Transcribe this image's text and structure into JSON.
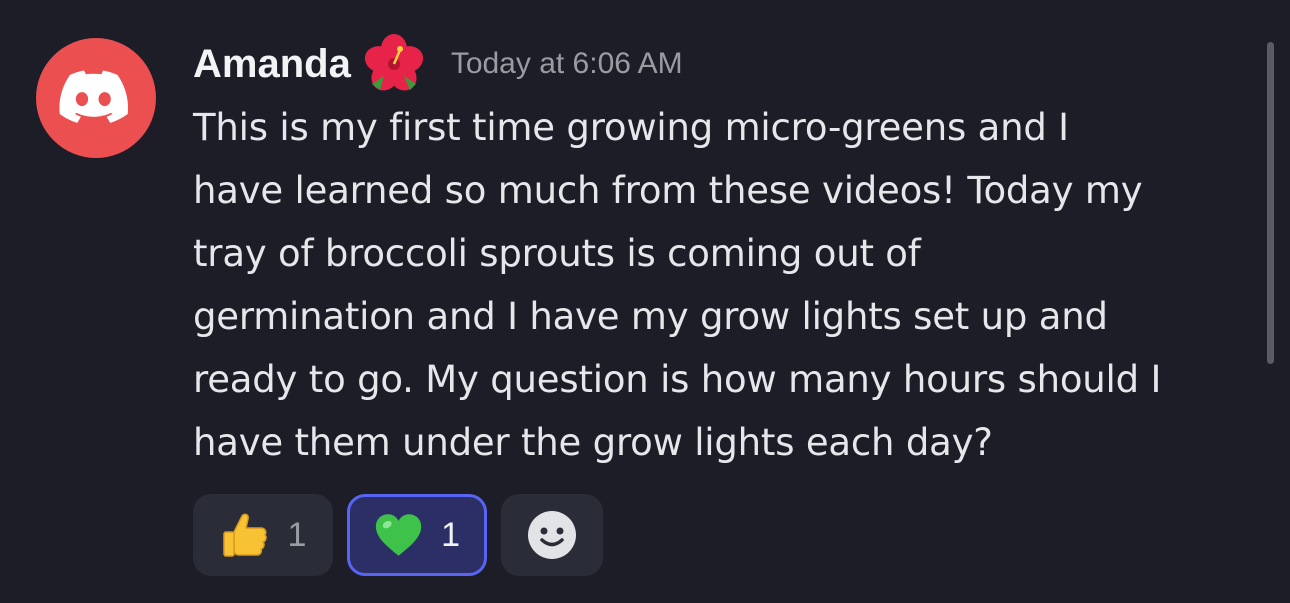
{
  "message": {
    "author": "Amanda",
    "author_badge_icon": "hibiscus-emoji",
    "timestamp": "Today at 6:06 AM",
    "avatar_icon": "discord-logo-icon",
    "avatar_color": "#eb4f4f",
    "text": "This is my first time growing micro-greens and I\nhave learned so much from these videos! Today my\ntray of broccoli sprouts is coming out of\ngermination and I have my grow lights set up and\nready to go. My question is how many hours should I\nhave them under the grow lights each day?"
  },
  "reactions": [
    {
      "emoji": "thumbs-up-emoji",
      "count": "1",
      "selected": false
    },
    {
      "emoji": "green-heart-emoji",
      "count": "1",
      "selected": true
    }
  ],
  "add_reaction_icon": "smiley-add-reaction-icon",
  "colors": {
    "background": "#1c1d27",
    "selected_reaction_border": "#5865f2",
    "selected_reaction_bg": "#2b2f66"
  }
}
